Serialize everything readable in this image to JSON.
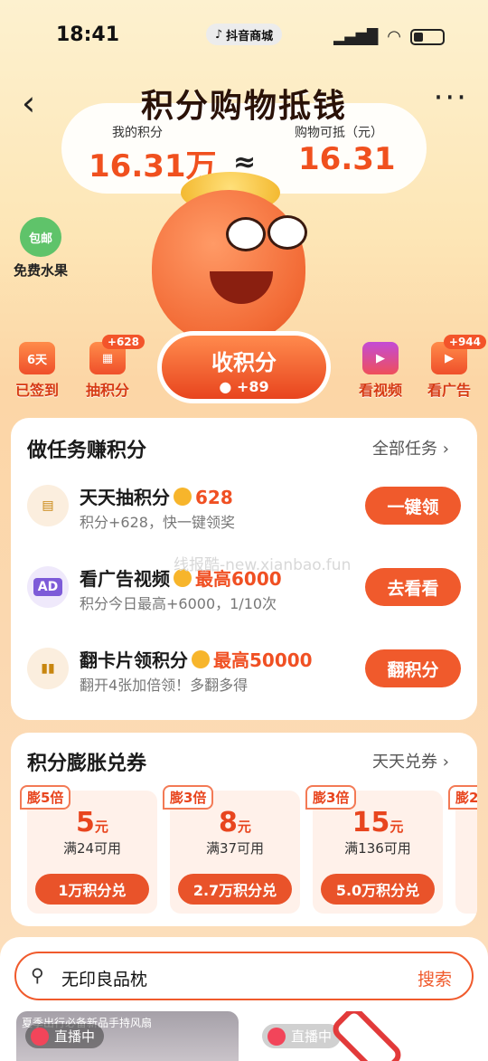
{
  "status_bar": {
    "time": "18:41",
    "app_pill": "抖音商城"
  },
  "header": {
    "title": "积分购物抵钱"
  },
  "points": {
    "my_points_label": "我的积分",
    "my_points_value": "16.31万",
    "approx": "≈",
    "deduct_label": "购物可抵（元）",
    "deduct_value": "16.31"
  },
  "fruit": {
    "badge": "包邮",
    "label": "免费水果"
  },
  "shortcuts": [
    {
      "label": "已签到",
      "icon_text": "6天",
      "badge": ""
    },
    {
      "label": "抽积分",
      "icon_text": "",
      "badge": "+628"
    },
    {
      "label": "看视频",
      "icon_text": "",
      "badge": ""
    },
    {
      "label": "看广告",
      "icon_text": "",
      "badge": "+944"
    }
  ],
  "collect": {
    "label": "收积分",
    "sub": "+89"
  },
  "tasks_card": {
    "title": "做任务赚积分",
    "link": "全部任务 ›",
    "tasks": [
      {
        "icon": "▤",
        "name": "天天抽积分",
        "reward": "628",
        "desc": "积分+628，快一键领奖",
        "button": "一键领"
      },
      {
        "icon": "AD",
        "name": "看广告视频",
        "reward": "最高6000",
        "desc": "积分今日最高+6000，1/10次",
        "button": "去看看"
      },
      {
        "icon": "▮▮",
        "name": "翻卡片领积分",
        "reward": "最高50000",
        "desc": "翻开4张加倍领！多翻多得",
        "button": "翻积分"
      }
    ]
  },
  "watermark": "线报酷-new.xianbao.fun",
  "coupon_card": {
    "title": "积分膨胀兑券",
    "link": "天天兑券 ›",
    "coupons": [
      {
        "badge": "膨5倍",
        "amount": "5",
        "unit": "元",
        "condition": "满24可用",
        "button": "1万积分兑"
      },
      {
        "badge": "膨3倍",
        "amount": "8",
        "unit": "元",
        "condition": "满37可用",
        "button": "2.7万积分兑"
      },
      {
        "badge": "膨3倍",
        "amount": "15",
        "unit": "元",
        "condition": "满136可用",
        "button": "5.0万积分兑"
      },
      {
        "badge": "膨2",
        "amount": "",
        "unit": "",
        "condition": "",
        "button": ""
      }
    ]
  },
  "search": {
    "value": "无印良品枕",
    "button": "搜索"
  },
  "live_cards": [
    {
      "badge": "直播中",
      "caption": "夏季出行必备新品手持风扇"
    },
    {
      "badge": "直播中",
      "caption": ""
    }
  ],
  "colors": {
    "accent": "#f05a2c",
    "points": "#f0501e",
    "title": "#2a1208"
  }
}
